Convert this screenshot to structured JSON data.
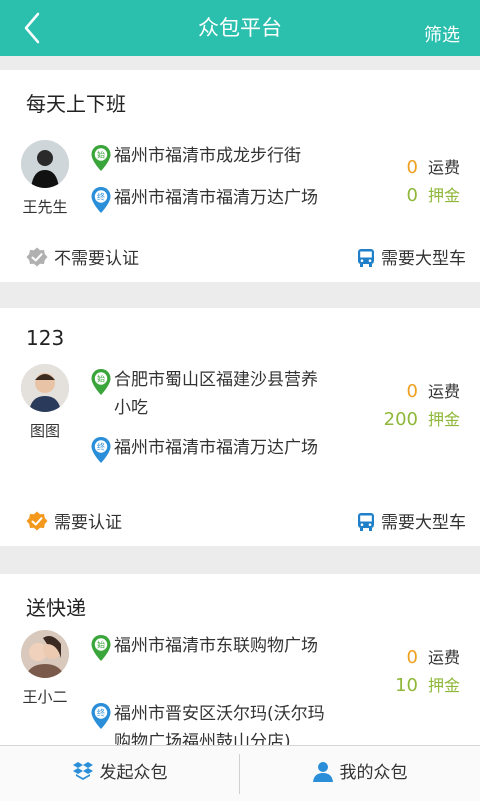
{
  "header": {
    "title": "众包平台",
    "filter_label": "筛选"
  },
  "tasks": [
    {
      "title": "每天上下班",
      "author": "王先生",
      "start_badge": "始",
      "start": "福州市福清市成龙步行街",
      "end_badge": "终",
      "end": "福州市福清市福清万达广场",
      "freight": "0",
      "freight_label": "运费",
      "deposit": "0",
      "deposit_label": "押金",
      "cert": "不需要认证",
      "vehicle": "需要大型车"
    },
    {
      "title": "123",
      "author": "图图",
      "start_badge": "始",
      "start": "合肥市蜀山区福建沙县营养小吃",
      "end_badge": "终",
      "end": "福州市福清市福清万达广场",
      "freight": "0",
      "freight_label": "运费",
      "deposit": "200",
      "deposit_label": "押金",
      "cert": "需要认证",
      "vehicle": "需要大型车"
    },
    {
      "title": "送快递",
      "author": "王小二",
      "start_badge": "始",
      "start": "福州市福清市东联购物广场",
      "end_badge": "终",
      "end": "福州市晋安区沃尔玛(沃尔玛购物广场福州鼓山分店)",
      "freight": "0",
      "freight_label": "运费",
      "deposit": "10",
      "deposit_label": "押金",
      "cert": "",
      "vehicle": ""
    }
  ],
  "bottom_bar": {
    "publish_label": "发起众包",
    "mine_label": "我的众包"
  },
  "colors": {
    "header": "#2bbfae",
    "freight_value": "#f0a020",
    "deposit_value": "#8fb83a",
    "start_pin": "#3aa53a",
    "end_pin": "#2a8fd8",
    "cert_required": "#f39a1e",
    "cert_not_required": "#b0b0b0",
    "vehicle_icon": "#1f7fc8",
    "bottom_icon": "#2a8fd8"
  },
  "icons": {
    "back": "chevron-left-icon",
    "start_pin": "map-pin-start-icon",
    "end_pin": "map-pin-end-icon",
    "cert": "verified-badge-icon",
    "vehicle": "bus-icon",
    "publish": "package-icon",
    "mine": "user-icon"
  }
}
